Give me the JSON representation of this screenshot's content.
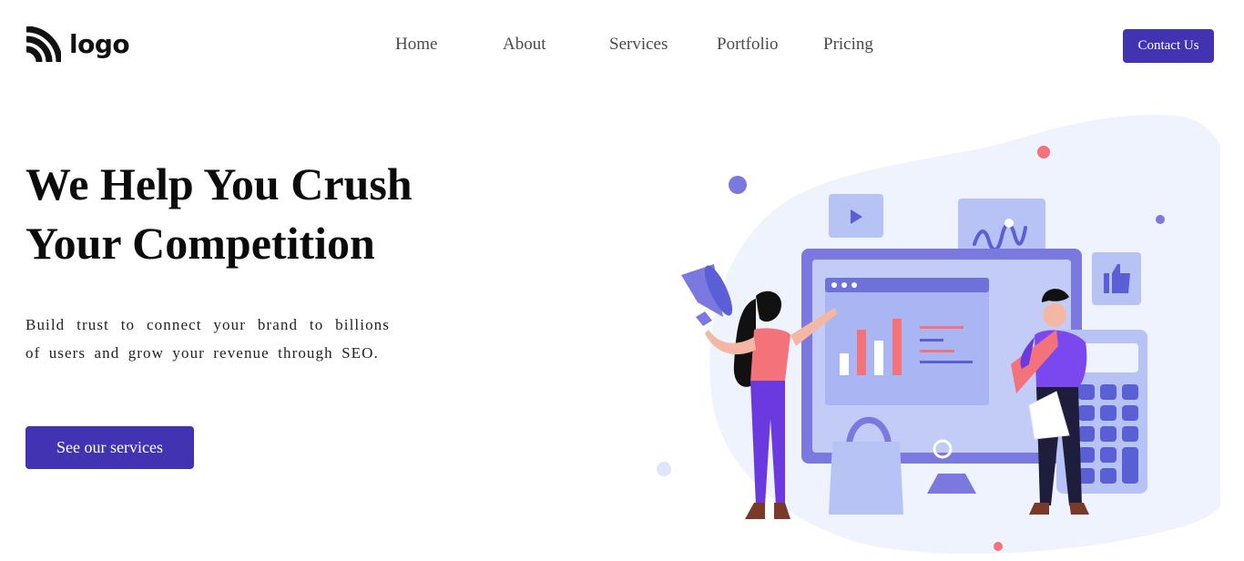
{
  "header": {
    "logo_text": "logo",
    "nav": [
      {
        "label": "Home"
      },
      {
        "label": "About"
      },
      {
        "label": "Services"
      },
      {
        "label": "Portfolio"
      },
      {
        "label": "Pricing"
      }
    ],
    "contact_label": "Contact Us"
  },
  "hero": {
    "title_line1": "We Help You Crush",
    "title_line2": "Your Competition",
    "description": "Build trust to connect your brand to billions of users and grow your revenue through SEO.",
    "cta_label": "See our services"
  },
  "colors": {
    "accent": "#4233b2",
    "illustration_blob": "#eef3fe",
    "illustration_primary": "#7b78e0",
    "illustration_coral": "#f4727a"
  },
  "icons": [
    "brand-logo-icon",
    "megaphone-icon",
    "play-icon",
    "thumbs-up-icon",
    "chart-icon",
    "calculator-icon",
    "shopping-bag-icon"
  ]
}
